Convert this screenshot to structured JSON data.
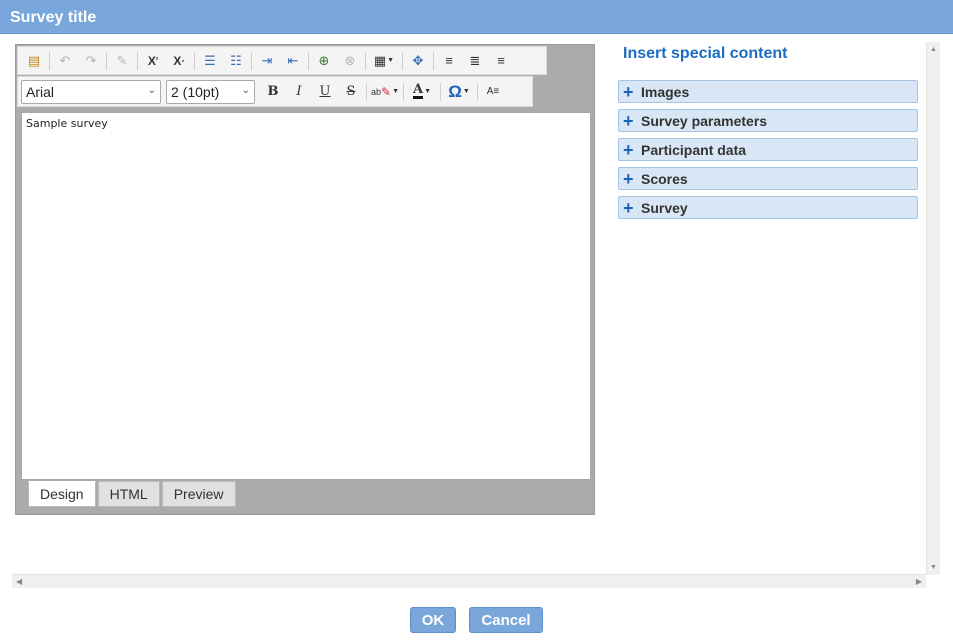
{
  "window": {
    "title": "Survey title"
  },
  "editor": {
    "toolbar1": {
      "buttons": [
        {
          "name": "paste-from-word-button",
          "glyph": "📋"
        },
        {
          "name": "undo-button",
          "glyph": "↶"
        },
        {
          "name": "redo-button",
          "glyph": "↷"
        },
        {
          "name": "format-stripper-button",
          "glyph": "✐"
        },
        {
          "name": "superscript-button",
          "glyph": "X²"
        },
        {
          "name": "subscript-button",
          "glyph": "X₂"
        },
        {
          "name": "ordered-list-button",
          "glyph": "☰"
        },
        {
          "name": "unordered-list-button",
          "glyph": "☷"
        },
        {
          "name": "indent-button",
          "glyph": "⇥"
        },
        {
          "name": "outdent-button",
          "glyph": "⇤"
        },
        {
          "name": "hyperlink-button",
          "glyph": "🔗"
        },
        {
          "name": "unlink-button",
          "glyph": "⛓"
        },
        {
          "name": "table-button",
          "glyph": "▦"
        },
        {
          "name": "toggle-screen-button",
          "glyph": "✥"
        },
        {
          "name": "align-left-button",
          "glyph": "≡"
        },
        {
          "name": "align-center-button",
          "glyph": "≣"
        },
        {
          "name": "align-right-button",
          "glyph": "≡"
        }
      ]
    },
    "toolbar2": {
      "font_name": "Arial",
      "font_size": "2 (10pt)",
      "bold": "B",
      "italic": "I",
      "underline": "U",
      "strike": "S",
      "highlight": "ab",
      "font_color": "A",
      "symbol": "Ω",
      "format_glyph": "A≡"
    },
    "content": "Sample survey",
    "tabs": [
      {
        "label": "Design",
        "active": true
      },
      {
        "label": "HTML",
        "active": false
      },
      {
        "label": "Preview",
        "active": false
      }
    ]
  },
  "special_content": {
    "title": "Insert special content",
    "items": [
      {
        "label": "Images"
      },
      {
        "label": "Survey parameters"
      },
      {
        "label": "Participant data"
      },
      {
        "label": "Scores"
      },
      {
        "label": "Survey"
      }
    ]
  },
  "footer": {
    "ok_label": "OK",
    "cancel_label": "Cancel"
  },
  "colors": {
    "title_bar": "#7aa7db",
    "accent_text": "#1c6cc1",
    "accordion_bg": "#d9e6f5"
  }
}
